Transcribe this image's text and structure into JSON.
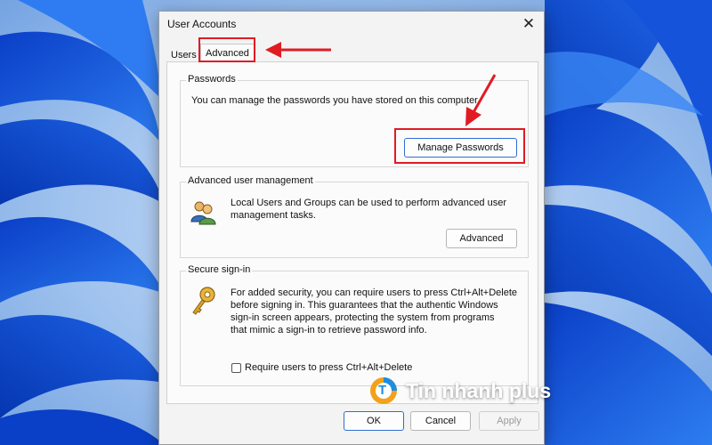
{
  "dialog": {
    "title": "User Accounts",
    "close_glyph": "✕"
  },
  "tabs": [
    {
      "label": "Users"
    },
    {
      "label": "Advanced"
    }
  ],
  "passwords": {
    "heading": "Passwords",
    "description": "You can manage the passwords you have stored on this computer.",
    "button_label": "Manage Passwords"
  },
  "advanced_user_management": {
    "heading": "Advanced user management",
    "description_line1": "Local Users and Groups can be used to perform advanced user",
    "description_line2": "management tasks.",
    "button_label": "Advanced",
    "icon": "users-group-icon"
  },
  "secure_signin": {
    "heading": "Secure sign-in",
    "description_line1": "For added security, you can require users to press Ctrl+Alt+Delete",
    "description_line2": "before signing in. This guarantees that the authentic Windows",
    "description_line3": "sign-in screen appears, protecting the system from programs",
    "description_line4": "that mimic a sign-in to retrieve password info.",
    "checkbox_label": "Require users to press Ctrl+Alt+Delete",
    "checkbox_checked": false,
    "icon": "key-icon"
  },
  "footer": {
    "ok_label": "OK",
    "cancel_label": "Cancel",
    "apply_label": "Apply"
  },
  "watermark": {
    "text": "Tin nhanh plus",
    "logo_letter": "T"
  },
  "colors": {
    "annotation_red": "#e01b24",
    "wallpaper_blue": "#1b5ad6"
  }
}
